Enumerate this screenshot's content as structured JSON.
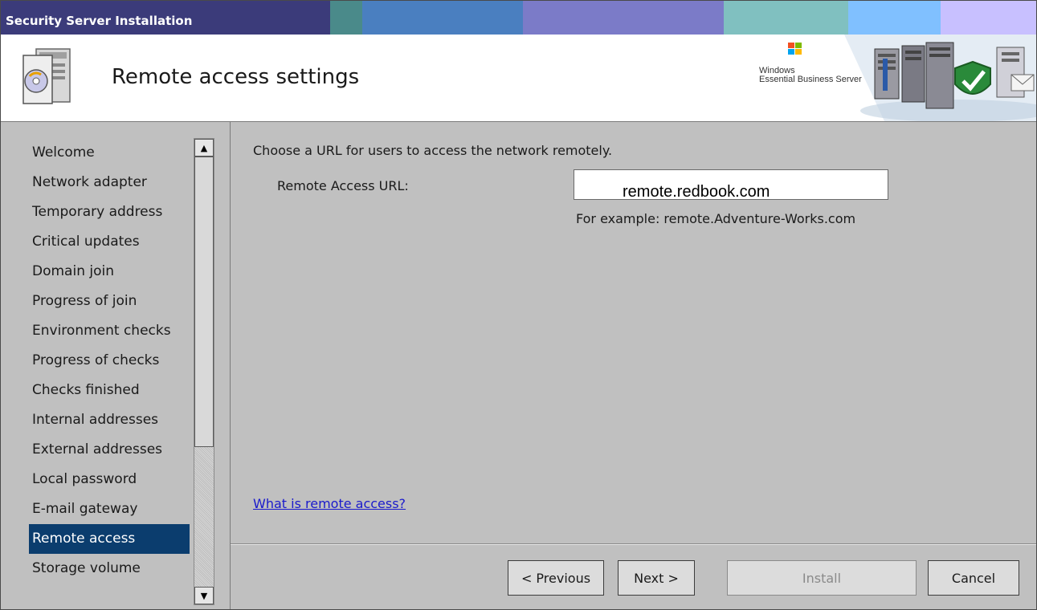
{
  "window": {
    "title": "Security Server Installation",
    "title_bar_colors": [
      "#3b3b7a",
      "#4a8a8a",
      "#4a7fc0",
      "#7b7bc8",
      "#80c0c0",
      "#80c0ff",
      "#c8c0ff"
    ]
  },
  "header": {
    "title": "Remote access settings",
    "brand_line1": "Windows",
    "brand_line2": "Essential Business Server"
  },
  "sidebar": {
    "items": [
      {
        "label": "Welcome",
        "active": false
      },
      {
        "label": "Network adapter",
        "active": false
      },
      {
        "label": "Temporary address",
        "active": false
      },
      {
        "label": "Critical updates",
        "active": false
      },
      {
        "label": "Domain join",
        "active": false
      },
      {
        "label": "Progress of join",
        "active": false
      },
      {
        "label": "Environment checks",
        "active": false
      },
      {
        "label": "Progress of checks",
        "active": false
      },
      {
        "label": "Checks finished",
        "active": false
      },
      {
        "label": "Internal addresses",
        "active": false
      },
      {
        "label": "External addresses",
        "active": false
      },
      {
        "label": "Local password",
        "active": false
      },
      {
        "label": "E-mail gateway",
        "active": false
      },
      {
        "label": "Remote access",
        "active": true
      },
      {
        "label": "Storage volume",
        "active": false
      }
    ],
    "active_color": "#0b3d6e"
  },
  "main": {
    "instruction": "Choose a URL for users to access the network remotely.",
    "url_label": "Remote Access URL:",
    "url_value": "remote.redbook.com",
    "example": "For example: remote.Adventure-Works.com",
    "help_link": "What is remote access?"
  },
  "buttons": {
    "previous": "< Previous",
    "next": "Next >",
    "install": "Install",
    "cancel": "Cancel"
  }
}
